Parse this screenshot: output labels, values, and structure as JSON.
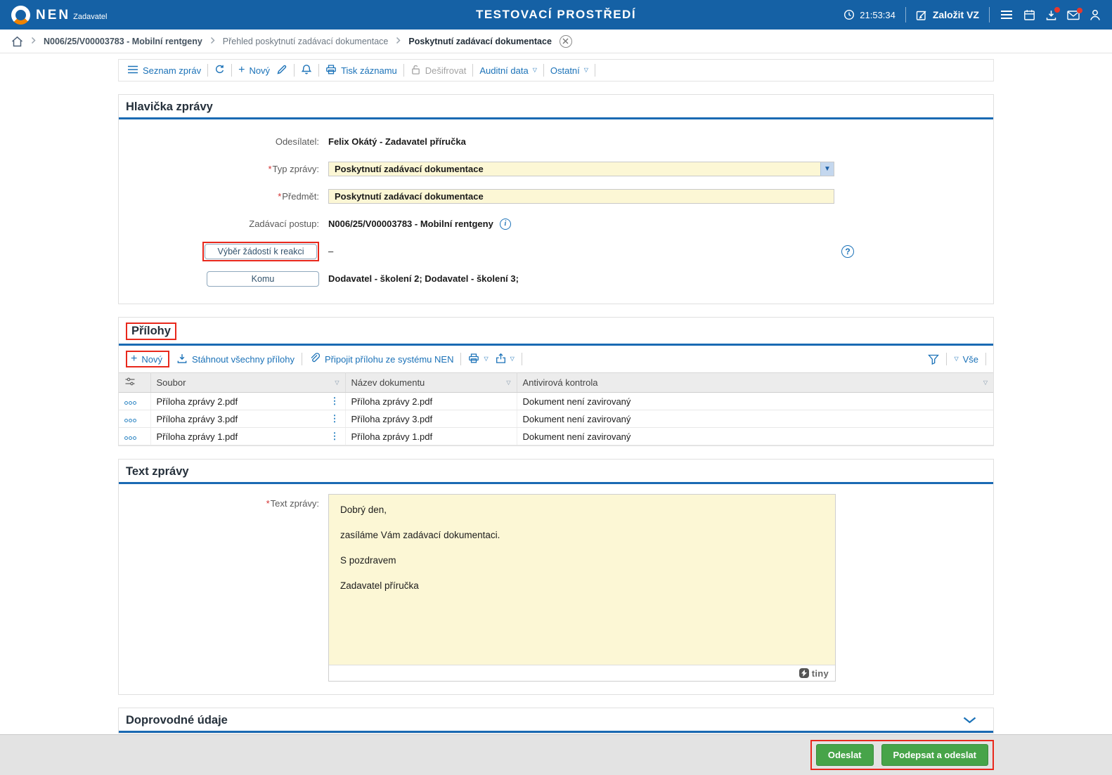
{
  "colors": {
    "header_bg": "#1561a5",
    "accent_blue": "#1b72b8",
    "field_yellow": "#fcf7d5",
    "annotation_red": "#e8281c",
    "button_green": "#47a449"
  },
  "header": {
    "brand": "NEN",
    "brand_sub": "Zadavatel",
    "env_title": "TESTOVACÍ PROSTŘEDÍ",
    "time": "21:53:34",
    "create_vz_label": "Založit VZ"
  },
  "breadcrumb": {
    "items": [
      "N006/25/V00003783 - Mobilní rentgeny",
      "Přehled poskytnutí zadávací dokumentace",
      "Poskytnutí zadávací dokumentace"
    ]
  },
  "record_toolbar": {
    "seznam_zprav": "Seznam zpráv",
    "novy": "Nový",
    "tisk_zaznamu": "Tisk záznamu",
    "desifrovat": "Dešifrovat",
    "auditni_data": "Auditní data",
    "ostatni": "Ostatní"
  },
  "required_mark": "*",
  "message_header": {
    "title": "Hlavička zprávy",
    "sender_label": "Odesílatel:",
    "sender_value": "Felix Okátý - Zadavatel příručka",
    "type_label": "Typ zprávy:",
    "type_value": "Poskytnutí zadávací dokumentace",
    "subject_label": "Předmět:",
    "subject_value": "Poskytnutí zadávací dokumentace",
    "procedure_label": "Zadávací postup:",
    "procedure_value": "N006/25/V00003783 - Mobilní rentgeny",
    "requests_button_label": "Výběr žádostí k reakci",
    "requests_value": "–",
    "recipients_button_label": "Komu",
    "recipients_value": "Dodavatel - školení 2; Dodavatel - školení 3;"
  },
  "attachments": {
    "title": "Přílohy",
    "novy": "Nový",
    "download_all": "Stáhnout všechny přílohy",
    "attach_from_nen": "Připojit přílohu ze systému NEN",
    "vse": "Vše",
    "columns": [
      "Soubor",
      "Název dokumentu",
      "Antivirová kontrola"
    ],
    "rows": [
      {
        "file": "Příloha zprávy 2.pdf",
        "doc_name": "Příloha zprávy 2.pdf",
        "antivirus": "Dokument není zavirovaný"
      },
      {
        "file": "Příloha zprávy 3.pdf",
        "doc_name": "Příloha zprávy 3.pdf",
        "antivirus": "Dokument není zavirovaný"
      },
      {
        "file": "Příloha zprávy 1.pdf",
        "doc_name": "Příloha zprávy 1.pdf",
        "antivirus": "Dokument není zavirovaný"
      }
    ]
  },
  "message_text": {
    "title": "Text zprávy",
    "label": "Text zprávy:",
    "paragraphs": [
      "Dobrý den,",
      "zasíláme Vám zadávací dokumentaci.",
      "S pozdravem",
      "Zadavatel příručka"
    ],
    "editor_brand": "tiny"
  },
  "additional_section": {
    "title": "Doprovodné údaje"
  },
  "footer": {
    "send_label": "Odeslat",
    "sign_send_label": "Podepsat a odeslat"
  }
}
